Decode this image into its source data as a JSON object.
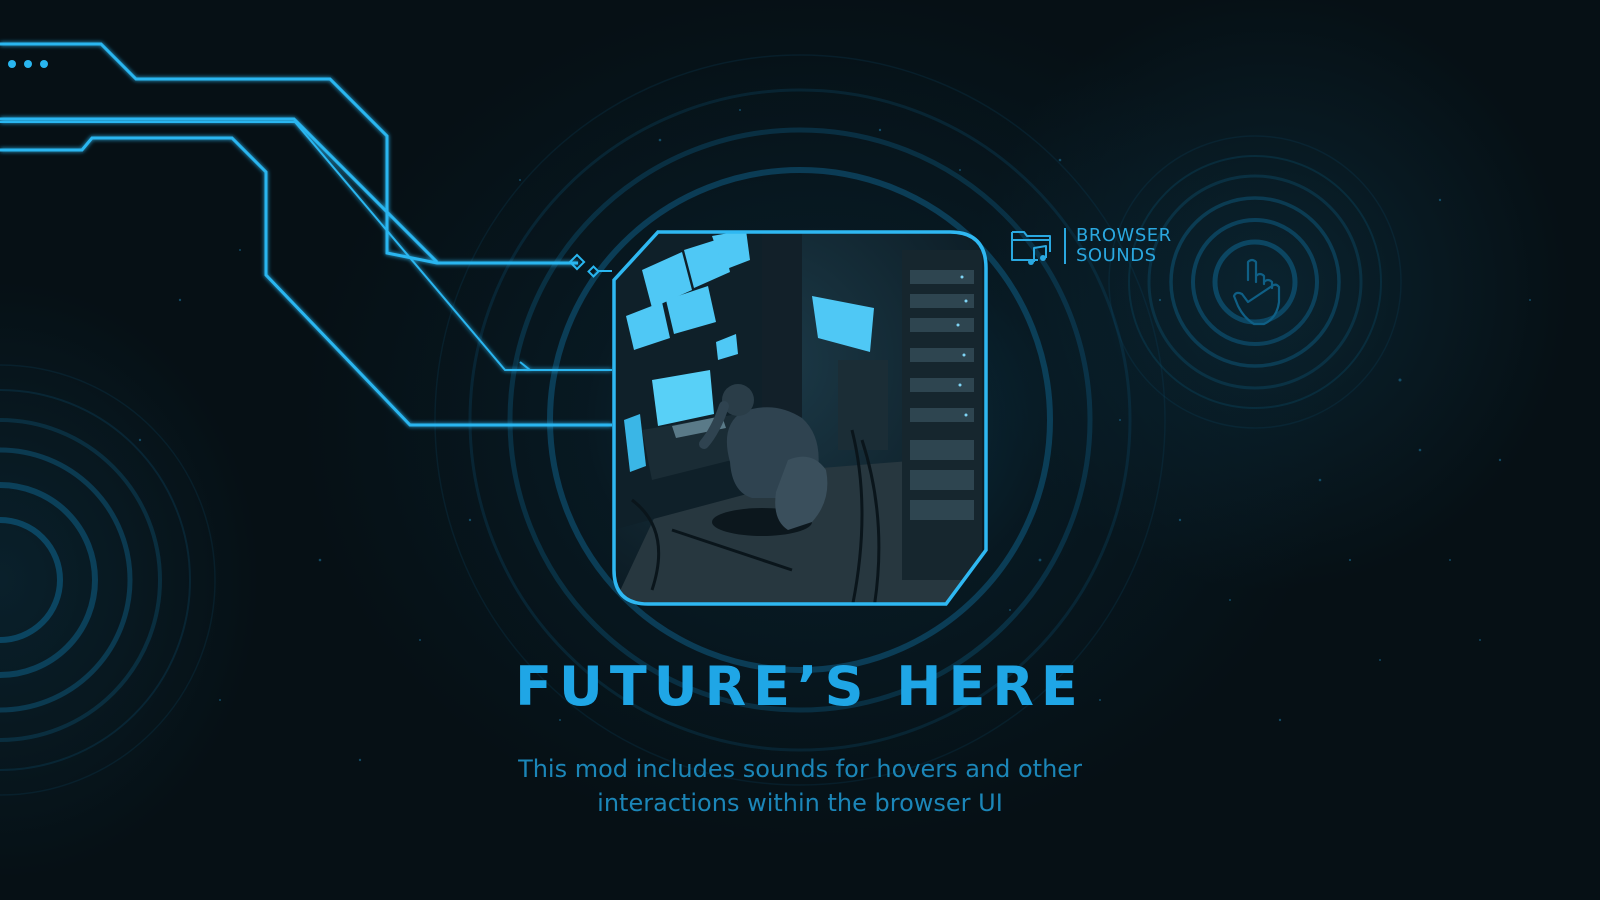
{
  "brand": {
    "line1": "BROWSER",
    "line2": "SOUNDS",
    "icon": "folder-music-icon"
  },
  "headline": "FUTURE’S HERE",
  "description": {
    "line1": "This mod includes sounds for hovers and other",
    "line2": "interactions within the browser UI"
  },
  "decor": {
    "window_dots_icon": "three-dots-icon",
    "pointer_icon": "hand-pointer-icon",
    "artwork": "server-room-illustration"
  },
  "colors": {
    "accent": "#1fa6e6",
    "accent_dim": "#1b86b8",
    "circuit": "#29b6f0",
    "background": "#061015"
  }
}
